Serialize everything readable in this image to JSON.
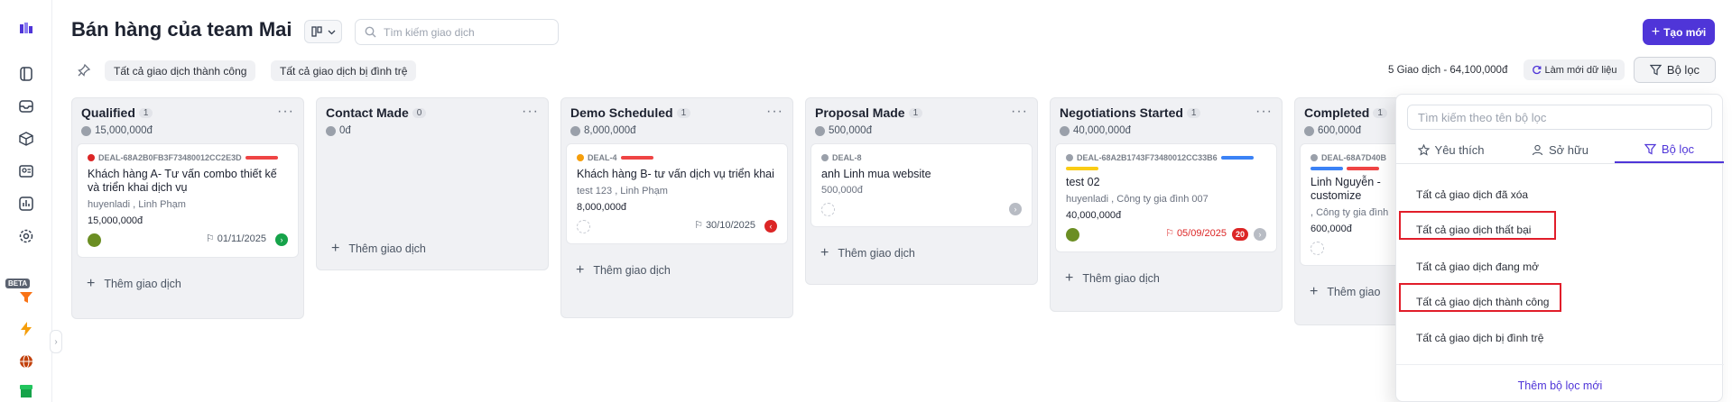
{
  "header": {
    "title": "Bán hàng của team Mai",
    "search_placeholder": "Tìm kiếm giao dịch",
    "new_button": "Tạo mới"
  },
  "toolbar": {
    "chips": [
      "Tất cả giao dịch thành công",
      "Tất cả giao dịch bị đình trệ"
    ],
    "summary": "5 Giao dịch - 64,100,000đ",
    "refresh": "Làm mới dữ liệu",
    "filter": "Bộ lọc"
  },
  "columns": [
    {
      "name": "Qualified",
      "count": "1",
      "amount": "15,000,000đ",
      "cards": [
        {
          "id": "DEAL-68A2B0FB3F73480012CC2E3D",
          "title": "Khách hàng A- Tư vấn combo thiết kế và triển khai dịch vụ",
          "meta": "huyenladi , Linh Phạm",
          "amount": "15,000,000đ",
          "due": "01/11/2025"
        }
      ],
      "add": "Thêm giao dịch"
    },
    {
      "name": "Contact Made",
      "count": "0",
      "amount": "0đ",
      "cards": [],
      "add": "Thêm giao dịch"
    },
    {
      "name": "Demo Scheduled",
      "count": "1",
      "amount": "8,000,000đ",
      "cards": [
        {
          "id": "DEAL-4",
          "title": "Khách hàng B- tư vấn dịch vụ triển khai",
          "meta": "test 123 , Linh Phạm",
          "amount": "8,000,000đ",
          "due": "30/10/2025"
        }
      ],
      "add": "Thêm giao dịch"
    },
    {
      "name": "Proposal Made",
      "count": "1",
      "amount": "500,000đ",
      "cards": [
        {
          "id": "DEAL-8",
          "title": "anh Linh mua website",
          "amount": "500,000đ"
        }
      ],
      "add": "Thêm giao dịch"
    },
    {
      "name": "Negotiations Started",
      "count": "1",
      "amount": "40,000,000đ",
      "cards": [
        {
          "id": "DEAL-68A2B1743F73480012CC33B6",
          "title": "test 02",
          "meta": "huyenladi , Công ty gia đình 007",
          "amount": "40,000,000đ",
          "due": "05/09/2025",
          "late": "20"
        }
      ],
      "add": "Thêm giao dịch"
    },
    {
      "name": "Completed",
      "count": "1",
      "amount": "600,000đ",
      "cards": [
        {
          "id": "DEAL-68A7D40B",
          "title": "Linh Nguyễn - customize",
          "meta": ", Công ty gia đình",
          "amount": "600,000đ"
        }
      ],
      "add": "Thêm giao"
    }
  ],
  "filter_popover": {
    "search_placeholder": "Tìm kiếm theo tên bộ lọc",
    "tabs": [
      "Yêu thích",
      "Sở hữu",
      "Bộ lọc"
    ],
    "items": [
      "Tất cả giao dịch đã xóa",
      "Tất cả giao dịch thất bại",
      "Tất cả giao dịch đang mở",
      "Tất cả giao dịch thành công",
      "Tất cả giao dịch bị đình trệ"
    ],
    "add": "Thêm bộ lọc mới"
  },
  "sidebar": {
    "beta": "BETA",
    "icons": [
      "logo-icon",
      "layers-icon",
      "inbox-icon",
      "box-icon",
      "contacts-icon",
      "report-icon",
      "settings-icon",
      "funnel-icon",
      "lightning-icon",
      "globe-icon",
      "store-icon"
    ]
  },
  "colors": {
    "accent": "#4f35d8",
    "danger": "#dc2626",
    "success": "#16a34a"
  }
}
